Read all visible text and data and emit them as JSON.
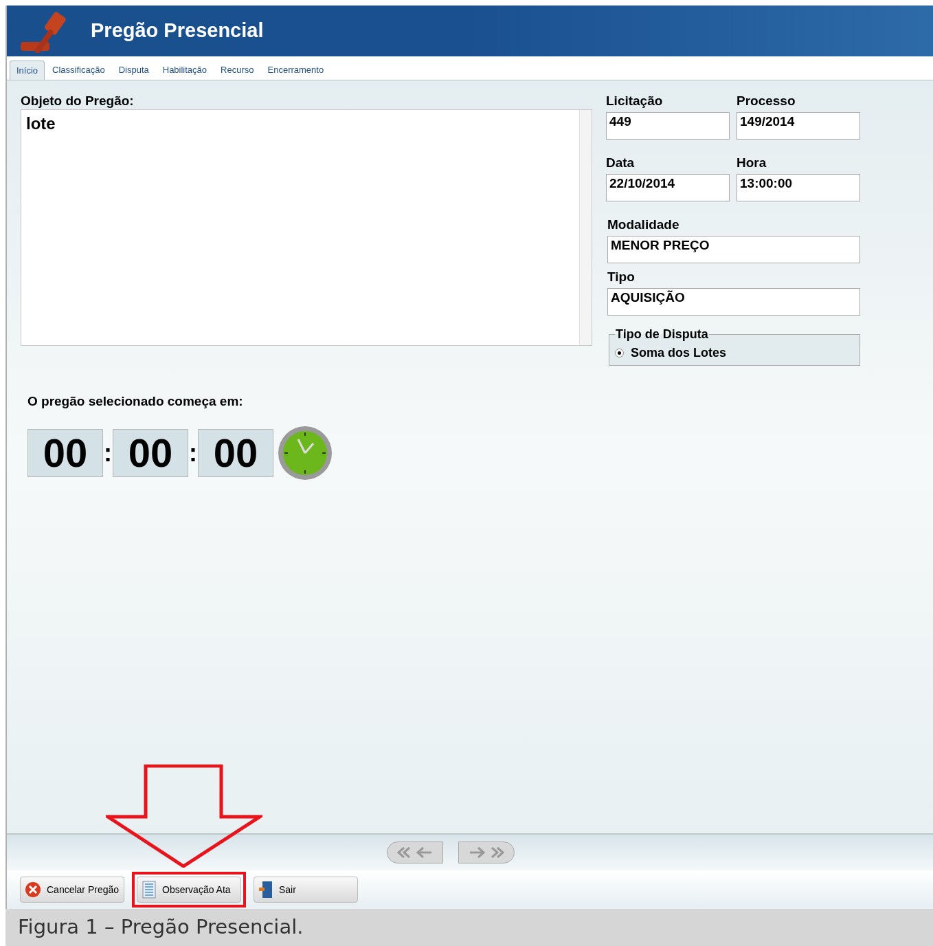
{
  "window": {
    "title": "Pregão Presencial"
  },
  "tabs": [
    {
      "label": "Início",
      "selected": true
    },
    {
      "label": "Classificação",
      "selected": false
    },
    {
      "label": "Disputa",
      "selected": false
    },
    {
      "label": "Habilitação",
      "selected": false
    },
    {
      "label": "Recurso",
      "selected": false
    },
    {
      "label": "Encerramento",
      "selected": false
    }
  ],
  "objeto": {
    "label": "Objeto do Pregão:",
    "value": "lote"
  },
  "fields": [
    {
      "label": "Licitação",
      "value": "449"
    },
    {
      "label": "Processo",
      "value": "149/2014"
    },
    {
      "label": "Data",
      "value": "22/10/2014"
    },
    {
      "label": "Hora",
      "value": "13:00:00"
    },
    {
      "label": "Modalidade",
      "value": "MENOR PREÇO"
    },
    {
      "label": "Tipo",
      "value": "AQUISIÇÃO"
    }
  ],
  "tipo_disputa": {
    "legend": "Tipo de Disputa",
    "options": [
      {
        "label": "Soma dos Lotes",
        "selected": true
      }
    ]
  },
  "countdown": {
    "label": "O pregão selecionado começa em:",
    "units": [
      "00",
      "00",
      "00"
    ],
    "separator": ":"
  },
  "buttons": [
    {
      "label": "Cancelar Pregão",
      "kind": "cancel",
      "highlighted": false
    },
    {
      "label": "Observação Ata",
      "kind": "notes",
      "highlighted": true
    },
    {
      "label": "Sair",
      "kind": "exit",
      "highlighted": false
    }
  ],
  "caption": "Figura 1 – Pregão Presencial."
}
